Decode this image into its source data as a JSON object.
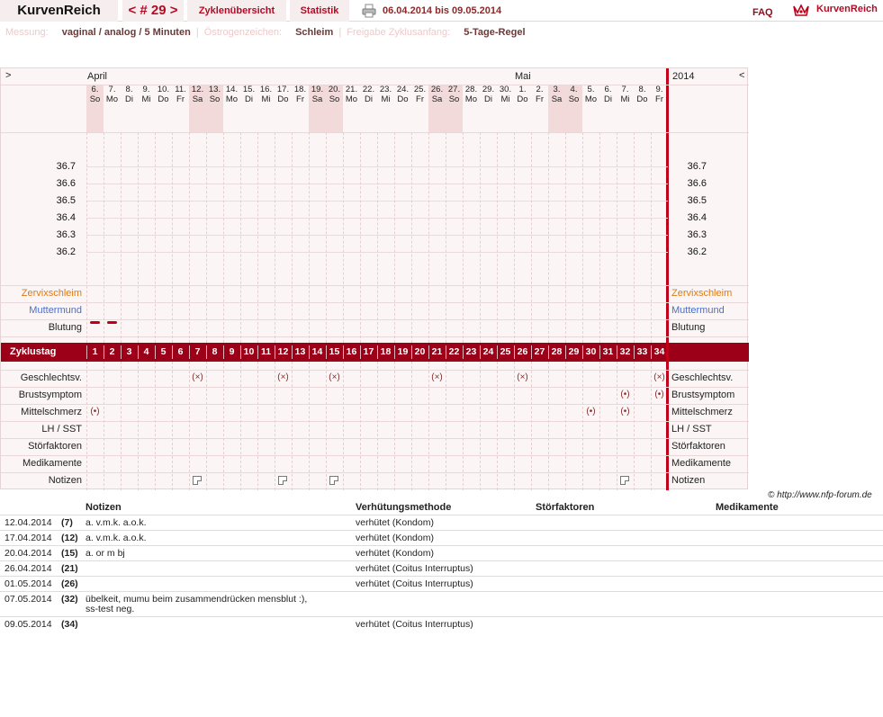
{
  "topbar": {
    "logo": "KurvenReich",
    "cycle": "< # 29 >",
    "overview": "Zyklenübersicht",
    "stats": "Statistik",
    "date_range": "06.04.2014 bis 09.05.2014",
    "faq": "FAQ",
    "brand": "KurvenReich"
  },
  "settings": {
    "measure_label": "Messung:",
    "measure_value": "vaginal / analog / 5 Minuten",
    "estrogen_label": "Östrogenzeichen:",
    "estrogen_value": "Schleim",
    "release_label": "Freigabe Zyklusanfang:",
    "release_value": "5-Tage-Regel",
    "sep": "|"
  },
  "chart": {
    "left_arrow": ">",
    "right_arrow": "<",
    "month1": "April",
    "month2": "Mai",
    "year": "2014",
    "days": [
      {
        "d": "6.",
        "w": "So",
        "we": true
      },
      {
        "d": "7.",
        "w": "Mo",
        "we": false
      },
      {
        "d": "8.",
        "w": "Di",
        "we": false
      },
      {
        "d": "9.",
        "w": "Mi",
        "we": false
      },
      {
        "d": "10.",
        "w": "Do",
        "we": false
      },
      {
        "d": "11.",
        "w": "Fr",
        "we": false
      },
      {
        "d": "12.",
        "w": "Sa",
        "we": true
      },
      {
        "d": "13.",
        "w": "So",
        "we": true
      },
      {
        "d": "14.",
        "w": "Mo",
        "we": false
      },
      {
        "d": "15.",
        "w": "Di",
        "we": false
      },
      {
        "d": "16.",
        "w": "Mi",
        "we": false
      },
      {
        "d": "17.",
        "w": "Do",
        "we": false
      },
      {
        "d": "18.",
        "w": "Fr",
        "we": false
      },
      {
        "d": "19.",
        "w": "Sa",
        "we": true
      },
      {
        "d": "20.",
        "w": "So",
        "we": true
      },
      {
        "d": "21.",
        "w": "Mo",
        "we": false
      },
      {
        "d": "22.",
        "w": "Di",
        "we": false
      },
      {
        "d": "23.",
        "w": "Mi",
        "we": false
      },
      {
        "d": "24.",
        "w": "Do",
        "we": false
      },
      {
        "d": "25.",
        "w": "Fr",
        "we": false
      },
      {
        "d": "26.",
        "w": "Sa",
        "we": true
      },
      {
        "d": "27.",
        "w": "So",
        "we": true
      },
      {
        "d": "28.",
        "w": "Mo",
        "we": false
      },
      {
        "d": "29.",
        "w": "Di",
        "we": false
      },
      {
        "d": "30.",
        "w": "Mi",
        "we": false
      },
      {
        "d": "1.",
        "w": "Do",
        "we": false
      },
      {
        "d": "2.",
        "w": "Fr",
        "we": false
      },
      {
        "d": "3.",
        "w": "Sa",
        "we": true
      },
      {
        "d": "4.",
        "w": "So",
        "we": true
      },
      {
        "d": "5.",
        "w": "Mo",
        "we": false
      },
      {
        "d": "6.",
        "w": "Di",
        "we": false
      },
      {
        "d": "7.",
        "w": "Mi",
        "we": false
      },
      {
        "d": "8.",
        "w": "Do",
        "we": false
      },
      {
        "d": "9.",
        "w": "Fr",
        "we": false
      }
    ],
    "temps": [
      "36.7",
      "36.6",
      "36.5",
      "36.4",
      "36.3",
      "36.2"
    ],
    "rows_top": [
      "Zervixschleim",
      "Muttermund",
      "Blutung"
    ],
    "cycle_label": "Zyklustag",
    "rows_bottom": [
      "Geschlechtsv.",
      "Brustsymptom",
      "Mittelschmerz",
      "LH / SST",
      "Störfaktoren",
      "Medikamente",
      "Notizen"
    ],
    "bleeding_days": [
      1,
      2
    ],
    "intercourse_days": [
      7,
      12,
      15,
      21,
      26,
      34
    ],
    "breast_days": [
      32,
      34
    ],
    "midpain_days": [
      1,
      30,
      32
    ],
    "note_days": [
      7,
      12,
      15,
      32
    ],
    "intercourse_symbol": "(×)",
    "breast_symbol": "(•)",
    "midpain_symbol": "(•)"
  },
  "copyright": "© http://www.nfp-forum.de",
  "notes_table": {
    "headers": {
      "notes": "Notizen",
      "method": "Verhütungsmethode",
      "disturb": "Störfaktoren",
      "meds": "Medikamente"
    },
    "rows": [
      {
        "date": "12.04.2014",
        "day": "(7)",
        "note": "a. v.m.k. a.o.k.",
        "method": "verhütet (Kondom)"
      },
      {
        "date": "17.04.2014",
        "day": "(12)",
        "note": "a. v.m.k. a.o.k.",
        "method": "verhütet (Kondom)"
      },
      {
        "date": "20.04.2014",
        "day": "(15)",
        "note": "a. or m bj",
        "method": "verhütet (Kondom)"
      },
      {
        "date": "26.04.2014",
        "day": "(21)",
        "note": "",
        "method": "verhütet (Coitus Interruptus)"
      },
      {
        "date": "01.05.2014",
        "day": "(26)",
        "note": "",
        "method": "verhütet (Coitus Interruptus)"
      },
      {
        "date": "07.05.2014",
        "day": "(32)",
        "note": "übelkeit, mumu beim zusammendrücken mensblut :),",
        "note2": "ss-test neg.",
        "method": ""
      },
      {
        "date": "09.05.2014",
        "day": "(34)",
        "note": "",
        "method": "verhütet (Coitus Interruptus)"
      }
    ]
  },
  "colors": {
    "accent": "#b30b24",
    "band": "#9c0018",
    "grid": "#fbf5f5"
  }
}
